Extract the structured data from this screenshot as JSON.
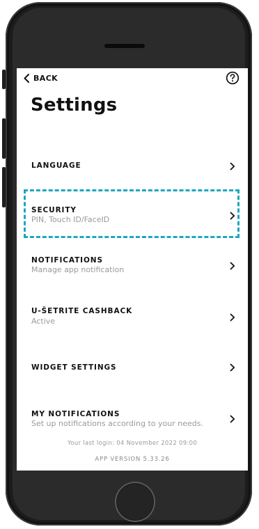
{
  "header": {
    "back_label": "BACK",
    "help_icon": "question-circle-icon",
    "title": "Settings"
  },
  "settings_items": [
    {
      "title": "LANGUAGE",
      "subtitle": ""
    },
    {
      "title": "SECURITY",
      "subtitle": "PIN, Touch ID/FaceID"
    },
    {
      "title": "NOTIFICATIONS",
      "subtitle": "Manage app notification"
    },
    {
      "title": "U-ŠETRITE CASHBACK",
      "subtitle": "Active"
    },
    {
      "title": "WIDGET SETTINGS",
      "subtitle": ""
    },
    {
      "title": "MY NOTIFICATIONS",
      "subtitle": "Set up notifications according to your needs."
    }
  ],
  "highlighted_item": "SECURITY",
  "footer": {
    "last_login": "Your last login: 04 November 2022 09:00",
    "app_version": "APP VERSION 5.33.26"
  },
  "colors": {
    "highlight_border": "#1ea6bf",
    "text_primary": "#111111",
    "text_secondary": "#9a9a9a",
    "device_body": "#1c1c1c"
  }
}
